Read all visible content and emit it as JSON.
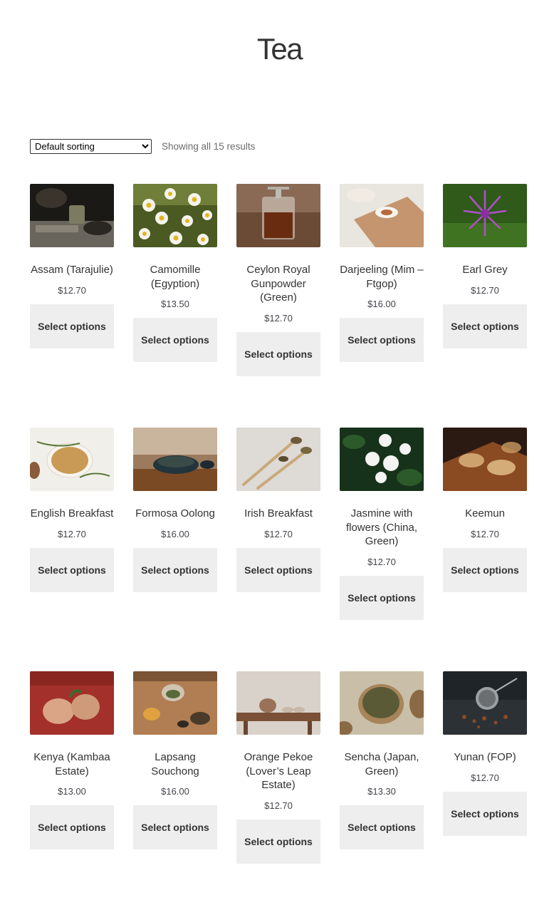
{
  "page_title": "Tea",
  "sorting": {
    "selected": "Default sorting",
    "options": [
      "Default sorting"
    ]
  },
  "result_count": "Showing all 15 results",
  "button_label": "Select options",
  "products": [
    {
      "name": "Assam (Tarajulie)",
      "price": "$12.70",
      "image": "tea-pouring-photo"
    },
    {
      "name": "Camomille (Egyption)",
      "price": "$13.50",
      "image": "camomile-flowers-photo"
    },
    {
      "name": "Ceylon Royal Gunpowder (Green)",
      "price": "$12.70",
      "image": "french-press-tea-photo"
    },
    {
      "name": "Darjeeling (Mim – Ftgop)",
      "price": "$16.00",
      "image": "tea-tray-photo"
    },
    {
      "name": "Earl Grey",
      "price": "$12.70",
      "image": "purple-flower-photo"
    },
    {
      "name": "English Breakfast",
      "price": "$12.70",
      "image": "herbal-tea-cup-photo"
    },
    {
      "name": "Formosa Oolong",
      "price": "$16.00",
      "image": "tea-bowl-photo"
    },
    {
      "name": "Irish Breakfast",
      "price": "$12.70",
      "image": "tea-spoons-photo"
    },
    {
      "name": "Jasmine with flowers (China, Green)",
      "price": "$12.70",
      "image": "jasmine-flowers-photo"
    },
    {
      "name": "Keemun",
      "price": "$12.70",
      "image": "glass-teacups-photo"
    },
    {
      "name": "Kenya (Kambaa Estate)",
      "price": "$13.00",
      "image": "hands-tea-leaf-photo"
    },
    {
      "name": "Lapsang Souchong",
      "price": "$16.00",
      "image": "tea-set-photo"
    },
    {
      "name": "Orange Pekoe (Lover’s Leap Estate)",
      "price": "$12.70",
      "image": "teapot-table-photo"
    },
    {
      "name": "Sencha (Japan, Green)",
      "price": "$13.30",
      "image": "green-tea-bowl-photo"
    },
    {
      "name": "Yunan (FOP)",
      "price": "$12.70",
      "image": "tea-infuser-photo"
    }
  ]
}
